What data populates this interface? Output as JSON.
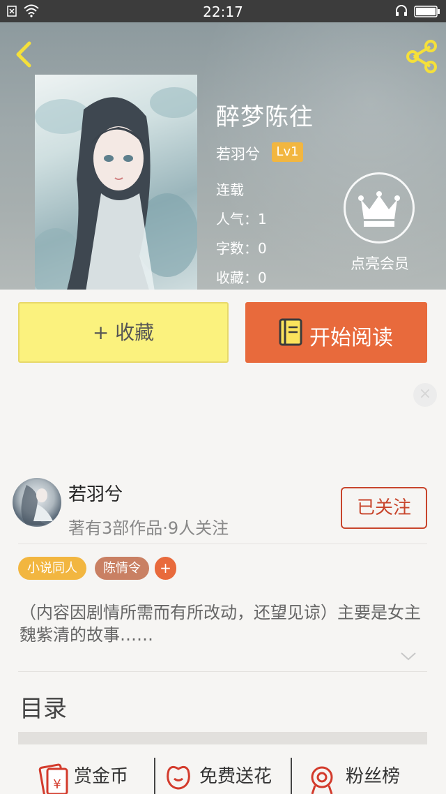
{
  "status_bar": {
    "time": "22:17"
  },
  "book": {
    "title": "醉梦陈往",
    "author": "若羽兮",
    "level": "Lv1",
    "status": "连载",
    "popularity": "人气：1",
    "word_count": "字数：0",
    "favorites": "收藏：0"
  },
  "vip": {
    "label": "点亮会员"
  },
  "actions": {
    "collect_label": "+ 收藏",
    "read_label": "开始阅读"
  },
  "author_card": {
    "name": "若羽兮",
    "stats": "著有3部作品·9人关注",
    "follow_label": "已关注"
  },
  "tags": [
    {
      "label": "小说同人",
      "color": "#f2b640"
    },
    {
      "label": "陈情令",
      "color": "#c98063"
    },
    {
      "label": "+",
      "color": "#e86a3c"
    }
  ],
  "description": "（内容因剧情所需而有所改动，还望见谅）主要是女主魏紫清的故事……",
  "toc": {
    "title": "目录"
  },
  "bottom_bar": {
    "items": [
      {
        "label": "赏金币",
        "icon": "red-envelope-icon"
      },
      {
        "label": "免费送花",
        "icon": "flower-icon"
      },
      {
        "label": "粉丝榜",
        "icon": "medal-icon"
      }
    ]
  },
  "colors": {
    "accent": "#e86a3c",
    "collect_bg": "#fbf27e",
    "follow": "#c8452c",
    "badge": "#f2b640"
  }
}
